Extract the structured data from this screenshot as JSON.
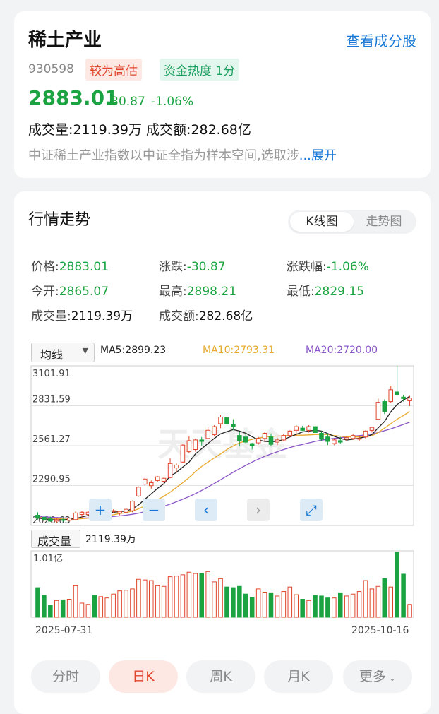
{
  "header": {
    "title": "稀土产业",
    "view_components": "查看成分股",
    "code": "930598",
    "valuation_tag": "较为高估",
    "heat_tag": "资金热度 1分",
    "price": "2883.01",
    "change": "-30.87",
    "change_pct": "-1.06%",
    "volume_line": "成交量:2119.39万  成交额:282.68亿",
    "description": "中证稀土产业指数以中证全指为样本空间,选取涉",
    "expand": "...展开"
  },
  "market": {
    "title": "行情走势",
    "tab_kline": "K线图",
    "tab_trend": "走势图",
    "stats": {
      "price_label": "价格:",
      "price": "2883.01",
      "chg_label": "涨跌:",
      "chg": "-30.87",
      "chgp_label": "涨跌幅:",
      "chgp": "-1.06%",
      "open_label": "今开:",
      "open": "2865.07",
      "high_label": "最高:",
      "high": "2898.21",
      "low_label": "最低:",
      "low": "2829.15",
      "vol_label": "成交量:",
      "vol": "2119.39万",
      "amt_label": "成交额:",
      "amt": "282.68亿"
    },
    "ma_select": "均线",
    "ma5": "MA5:2899.23",
    "ma10": "MA10:2793.31",
    "ma20": "MA20:2720.00",
    "vol_select": "成交量",
    "vol_value": "2119.39万",
    "periods": [
      "分时",
      "日K",
      "周K",
      "月K",
      "更多"
    ]
  },
  "colors": {
    "up": "#e0452c",
    "down": "#1aa340",
    "ma5": "#222222",
    "ma10": "#e8a92e",
    "ma20": "#8a55c8",
    "link": "#1677d6"
  },
  "chart_data": {
    "type": "candlestick",
    "ylim": [
      2020.63,
      3101.91
    ],
    "y_ticks": [
      "3101.91",
      "2831.59",
      "2561.27",
      "2290.95",
      "2020.63"
    ],
    "x_start_label": "2025-07-31",
    "x_end_label": "2025-10-16",
    "volume_max_label": "1.01亿",
    "ohlc": [
      [
        2090,
        2110,
        2060,
        2070
      ],
      [
        2075,
        2085,
        2050,
        2060
      ],
      [
        2065,
        2080,
        2045,
        2050
      ],
      [
        2050,
        2070,
        2035,
        2060
      ],
      [
        2060,
        2075,
        2045,
        2055
      ],
      [
        2055,
        2075,
        2050,
        2070
      ],
      [
        2060,
        2115,
        2055,
        2105
      ],
      [
        2095,
        2120,
        2075,
        2110
      ],
      [
        2095,
        2120,
        2080,
        2110
      ],
      [
        2105,
        2115,
        2085,
        2095
      ],
      [
        2090,
        2120,
        2085,
        2110
      ],
      [
        2105,
        2125,
        2095,
        2115
      ],
      [
        2115,
        2130,
        2105,
        2120
      ],
      [
        2105,
        2120,
        2090,
        2115
      ],
      [
        2110,
        2135,
        2105,
        2130
      ],
      [
        2120,
        2190,
        2110,
        2185
      ],
      [
        2220,
        2285,
        2215,
        2280
      ],
      [
        2300,
        2345,
        2290,
        2335
      ],
      [
        2290,
        2325,
        2270,
        2310
      ],
      [
        2325,
        2355,
        2315,
        2350
      ],
      [
        2320,
        2345,
        2310,
        2340
      ],
      [
        2345,
        2475,
        2340,
        2440
      ],
      [
        2410,
        2440,
        2380,
        2430
      ],
      [
        2450,
        2570,
        2445,
        2565
      ],
      [
        2520,
        2625,
        2510,
        2595
      ],
      [
        2535,
        2610,
        2520,
        2600
      ],
      [
        2600,
        2620,
        2560,
        2590
      ],
      [
        2610,
        2690,
        2605,
        2665
      ],
      [
        2635,
        2700,
        2625,
        2690
      ],
      [
        2710,
        2770,
        2680,
        2755
      ],
      [
        2750,
        2760,
        2695,
        2710
      ],
      [
        2705,
        2740,
        2665,
        2690
      ],
      [
        2630,
        2655,
        2555,
        2595
      ],
      [
        2620,
        2645,
        2570,
        2585
      ],
      [
        2575,
        2580,
        2535,
        2560
      ],
      [
        2580,
        2620,
        2570,
        2610
      ],
      [
        2610,
        2655,
        2595,
        2645
      ],
      [
        2620,
        2645,
        2555,
        2570
      ],
      [
        2585,
        2615,
        2565,
        2600
      ],
      [
        2600,
        2640,
        2590,
        2630
      ],
      [
        2630,
        2665,
        2620,
        2660
      ],
      [
        2665,
        2700,
        2625,
        2690
      ],
      [
        2680,
        2695,
        2660,
        2665
      ],
      [
        2665,
        2700,
        2650,
        2690
      ],
      [
        2690,
        2705,
        2640,
        2650
      ],
      [
        2645,
        2660,
        2595,
        2605
      ],
      [
        2620,
        2645,
        2565,
        2590
      ],
      [
        2575,
        2610,
        2565,
        2600
      ],
      [
        2595,
        2620,
        2575,
        2585
      ],
      [
        2605,
        2625,
        2595,
        2615
      ],
      [
        2610,
        2640,
        2600,
        2630
      ],
      [
        2605,
        2630,
        2595,
        2610
      ],
      [
        2620,
        2665,
        2610,
        2660
      ],
      [
        2665,
        2690,
        2650,
        2685
      ],
      [
        2740,
        2880,
        2735,
        2855
      ],
      [
        2860,
        2875,
        2775,
        2790
      ],
      [
        2860,
        2965,
        2850,
        2940
      ],
      [
        2925,
        3101.91,
        2900,
        2905
      ],
      [
        2890,
        2905,
        2860,
        2880
      ],
      [
        2865,
        2898.21,
        2829.15,
        2883.01
      ]
    ],
    "volume": [
      0.46,
      0.34,
      0.19,
      0.26,
      0.27,
      0.28,
      0.49,
      0.22,
      0.2,
      0.34,
      0.32,
      0.3,
      0.36,
      0.41,
      0.42,
      0.44,
      0.59,
      0.58,
      0.57,
      0.49,
      0.48,
      0.63,
      0.64,
      0.66,
      0.7,
      0.68,
      0.68,
      0.71,
      0.55,
      0.6,
      0.47,
      0.46,
      0.48,
      0.36,
      0.31,
      0.44,
      0.39,
      0.38,
      0.33,
      0.4,
      0.47,
      0.35,
      0.28,
      0.26,
      0.34,
      0.33,
      0.3,
      0.3,
      0.38,
      0.33,
      0.36,
      0.4,
      0.57,
      0.44,
      0.48,
      0.6,
      0.47,
      1.01,
      0.67,
      0.2
    ],
    "ma5": [
      2070,
      2066,
      2060,
      2058,
      2059,
      2062,
      2068,
      2078,
      2088,
      2097,
      2104,
      2109,
      2110,
      2114,
      2118,
      2133,
      2160,
      2198,
      2235,
      2272,
      2303,
      2355,
      2380,
      2416,
      2450,
      2505,
      2540,
      2576,
      2610,
      2641,
      2656,
      2670,
      2660,
      2645,
      2622,
      2600,
      2590,
      2588,
      2590,
      2604,
      2620,
      2638,
      2654,
      2660,
      2665,
      2660,
      2643,
      2625,
      2610,
      2599,
      2605,
      2612,
      2620,
      2636,
      2682,
      2725,
      2790,
      2840,
      2870,
      2895
    ],
    "ma10": [
      2075,
      2072,
      2069,
      2066,
      2064,
      2062,
      2063,
      2066,
      2070,
      2074,
      2080,
      2086,
      2093,
      2101,
      2107,
      2118,
      2133,
      2153,
      2174,
      2195,
      2218,
      2246,
      2278,
      2310,
      2345,
      2385,
      2420,
      2450,
      2478,
      2505,
      2535,
      2560,
      2580,
      2594,
      2604,
      2612,
      2620,
      2624,
      2626,
      2628,
      2630,
      2632,
      2632,
      2634,
      2636,
      2638,
      2636,
      2630,
      2625,
      2622,
      2620,
      2620,
      2622,
      2628,
      2650,
      2680,
      2710,
      2740,
      2765,
      2793
    ],
    "ma20": [
      2080,
      2078,
      2076,
      2074,
      2072,
      2071,
      2070,
      2071,
      2072,
      2073,
      2075,
      2078,
      2081,
      2085,
      2090,
      2096,
      2104,
      2114,
      2125,
      2137,
      2150,
      2165,
      2181,
      2198,
      2216,
      2236,
      2258,
      2281,
      2305,
      2330,
      2356,
      2381,
      2405,
      2428,
      2450,
      2470,
      2489,
      2505,
      2520,
      2535,
      2548,
      2560,
      2570,
      2580,
      2590,
      2598,
      2605,
      2610,
      2615,
      2620,
      2625,
      2629,
      2634,
      2640,
      2650,
      2662,
      2675,
      2690,
      2705,
      2720
    ]
  }
}
